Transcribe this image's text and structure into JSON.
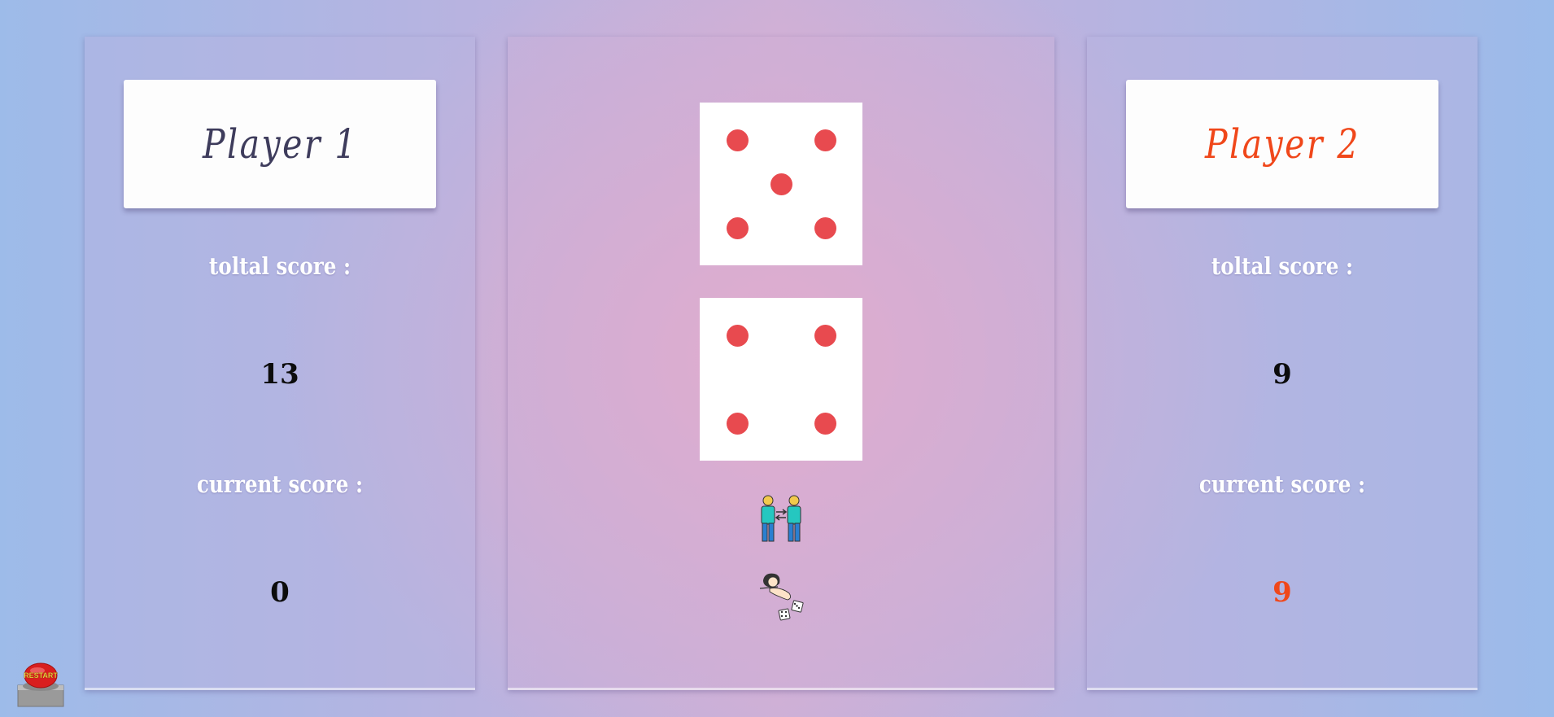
{
  "players": [
    {
      "name": "Player 1",
      "total_score_label": "toltal score :",
      "total_score": "13",
      "current_score_label": "current score :",
      "current_score": "0",
      "accent_color": "#3e3c5c"
    },
    {
      "name": "Player 2",
      "total_score_label": "toltal score :",
      "total_score": "9",
      "current_score_label": "current score :",
      "current_score": "9",
      "accent_color": "#f0471a"
    }
  ],
  "dice": [
    {
      "value": 5
    },
    {
      "value": 4
    }
  ],
  "controls": {
    "switch_icon": "switch-players-icon",
    "roll_icon": "roll-dice-icon",
    "restart_label": "RESTART"
  },
  "colors": {
    "pip": "#e84a4f",
    "active_player": "#f0471a"
  }
}
